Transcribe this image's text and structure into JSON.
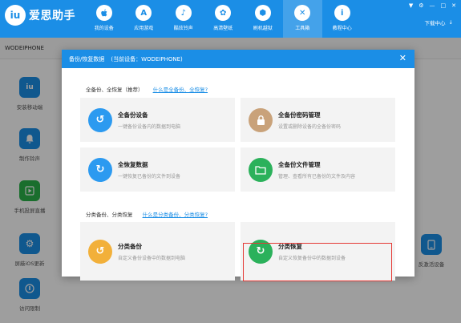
{
  "app": {
    "logo_text": "爱思助手",
    "logo_glyph": "iu"
  },
  "nav": [
    {
      "label": "我的设备",
      "icon": "apple-icon",
      "glyph": ""
    },
    {
      "label": "应用游戏",
      "icon": "appstore-icon",
      "glyph": "A"
    },
    {
      "label": "酷炫铃声",
      "icon": "bell-icon",
      "glyph": "♪"
    },
    {
      "label": "高清壁纸",
      "icon": "wallpaper-icon",
      "glyph": "✿"
    },
    {
      "label": "刷机越狱",
      "icon": "box-icon",
      "glyph": "⬢"
    },
    {
      "label": "工具箱",
      "icon": "toolbox-icon",
      "glyph": "✕"
    },
    {
      "label": "教程中心",
      "icon": "info-icon",
      "glyph": "i"
    }
  ],
  "window_controls": [
    "▼",
    "⚙",
    "—",
    "□",
    "✕"
  ],
  "download": {
    "label": "下载中心",
    "arrow": "↓"
  },
  "device": {
    "name": "WODEIPHONE"
  },
  "tools": [
    {
      "label": "安装移动端",
      "glyph": "iu",
      "color": "#1b8ee6"
    },
    {
      "label": "制作铃声",
      "glyph": "🔔",
      "color": "#1b8ee6"
    },
    {
      "label": "手机投屏直播",
      "glyph": "▶",
      "color": "#2ab24a"
    },
    {
      "label": "屏蔽iOS更新",
      "glyph": "⚙",
      "color": "#1b8ee6"
    },
    {
      "label": "访问限制",
      "glyph": "🔒",
      "color": "#1b8ee6"
    }
  ],
  "right_tool": {
    "label": "反激活设备",
    "glyph": "▢",
    "color": "#1b8ee6"
  },
  "dialog": {
    "title": "备份/恢复数据",
    "current_device": "(当前设备：WODEIPHONE)",
    "close": "✕",
    "section1": {
      "title": "全备份、全恢复（推荐）",
      "link": "什么是全备份、全恢复?"
    },
    "section2": {
      "title": "分类备份、分类恢复",
      "link": "什么是分类备份、分类恢复?"
    },
    "cards": [
      {
        "title": "全备份设备",
        "desc": "一键备份设备内的数据到电脑",
        "color": "#2c9af0",
        "glyph": "↺"
      },
      {
        "title": "全备份密码管理",
        "desc": "设置或删除设备的全备份密码",
        "color": "#c9a27a",
        "glyph": "🔒"
      },
      {
        "title": "全恢复数据",
        "desc": "一键恢复已备份的文件到设备",
        "color": "#2c9af0",
        "glyph": "↻"
      },
      {
        "title": "全备份文件管理",
        "desc": "管理、查看所有已备份的文件及内容",
        "color": "#2bb15b",
        "glyph": "▭"
      },
      {
        "title": "分类备份",
        "desc": "自定义备份设备中的数据到电脑",
        "color": "#f2b03a",
        "glyph": "↺"
      },
      {
        "title": "分类恢复",
        "desc": "自定义恢复备份中的数据到设备",
        "color": "#2bb15b",
        "glyph": "↻"
      }
    ]
  }
}
